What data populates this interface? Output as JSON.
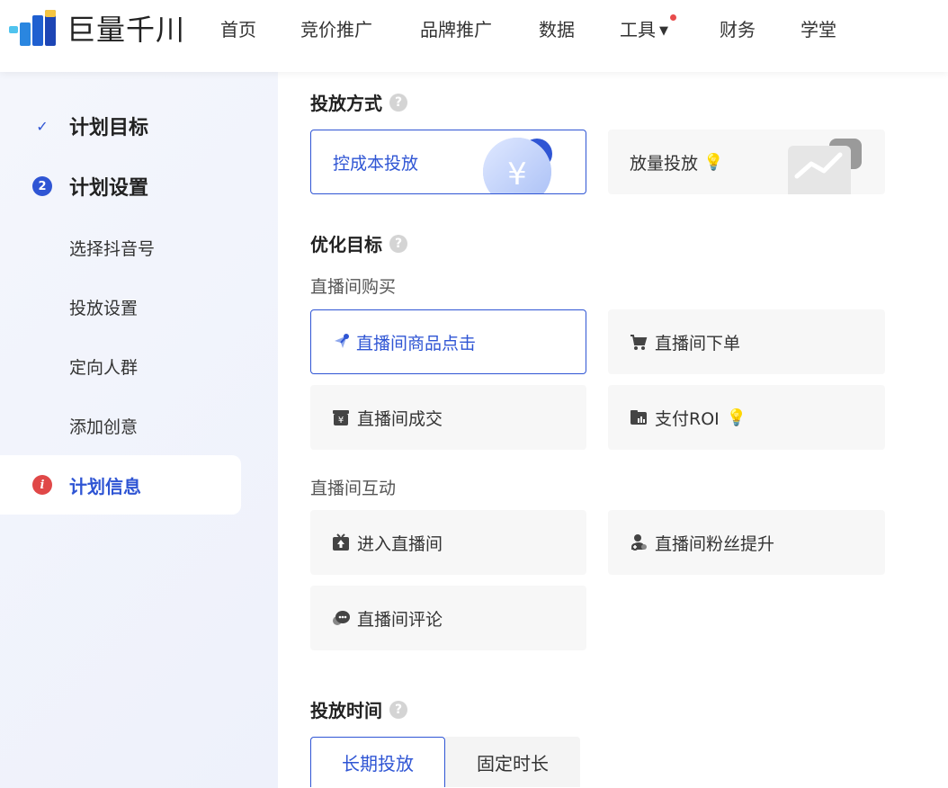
{
  "header": {
    "logo_text": "巨量千川",
    "nav": [
      {
        "label": "首页"
      },
      {
        "label": "竞价推广"
      },
      {
        "label": "品牌推广"
      },
      {
        "label": "数据"
      },
      {
        "label": "工具"
      },
      {
        "label": "财务"
      },
      {
        "label": "学堂"
      }
    ]
  },
  "sidebar": {
    "steps": [
      {
        "label": "计划目标",
        "status": "done",
        "icon": "check-icon"
      },
      {
        "label": "计划设置",
        "status": "current",
        "number": "2"
      }
    ],
    "sub_items": [
      {
        "label": "选择抖音号"
      },
      {
        "label": "投放设置"
      },
      {
        "label": "定向人群"
      },
      {
        "label": "添加创意"
      }
    ],
    "info": {
      "label": "计划信息",
      "icon": "info-icon",
      "badge": "i"
    }
  },
  "main": {
    "delivery_method": {
      "title": "投放方式",
      "options": [
        {
          "label": "控成本投放",
          "selected": true,
          "icon": "yen-coin-icon"
        },
        {
          "label": "放量投放",
          "selected": false,
          "icon": "lightbulb-icon"
        }
      ]
    },
    "optimization": {
      "title": "优化目标",
      "groups": [
        {
          "title": "直播间购买",
          "options": [
            {
              "label": "直播间商品点击",
              "selected": true,
              "icon": "cursor-click-icon"
            },
            {
              "label": "直播间下单",
              "selected": false,
              "icon": "cart-icon"
            },
            {
              "label": "直播间成交",
              "selected": false,
              "icon": "yen-box-icon"
            },
            {
              "label": "支付ROI",
              "selected": false,
              "icon": "wallet-chart-icon"
            }
          ]
        },
        {
          "title": "直播间互动",
          "options": [
            {
              "label": "进入直播间",
              "selected": false,
              "icon": "tv-enter-icon"
            },
            {
              "label": "直播间粉丝提升",
              "selected": false,
              "icon": "user-add-icon"
            },
            {
              "label": "直播间评论",
              "selected": false,
              "icon": "chat-icon"
            }
          ]
        }
      ]
    },
    "delivery_time": {
      "title": "投放时间",
      "tabs": [
        {
          "label": "长期投放",
          "selected": true
        },
        {
          "label": "固定时长",
          "selected": false
        }
      ]
    }
  },
  "colors": {
    "accent": "#2f55d4",
    "sidebar_bg": "#f1f4fb",
    "card_bg": "#f7f7f7",
    "info_red": "#e04848",
    "nav_dot": "#e84b4b"
  }
}
